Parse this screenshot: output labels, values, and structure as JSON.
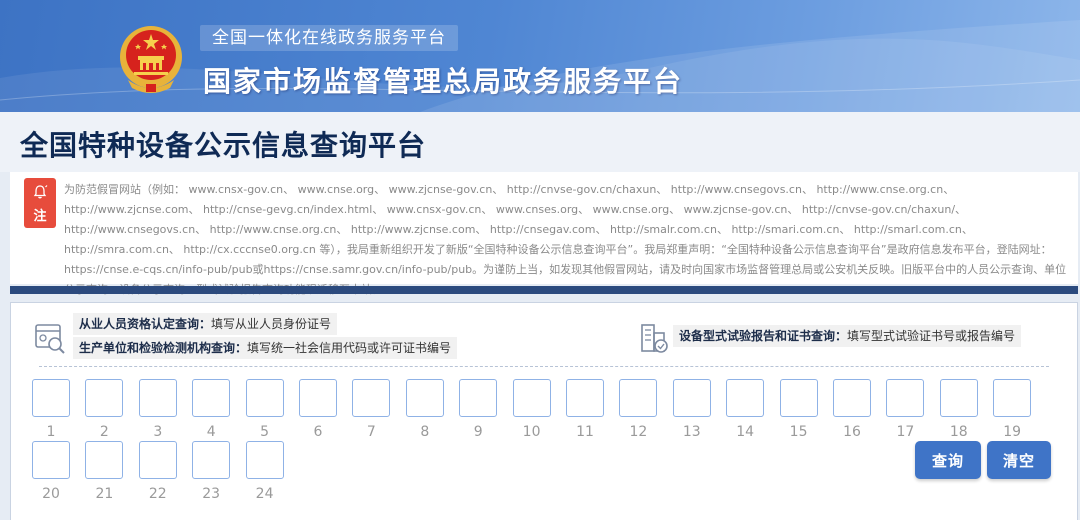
{
  "header": {
    "platform_subtitle": "全国一体化在线政务服务平台",
    "platform_title": "国家市场监督管理总局政务服务平台"
  },
  "page": {
    "title": "全国特种设备公示信息查询平台"
  },
  "notice": {
    "badge_label": "注",
    "text": "为防范假冒网站（例如： www.cnsx-gov.cn、 www.cnse.org、 www.zjcnse-gov.cn、 http://cnvse-gov.cn/chaxun、 http://www.cnsegovs.cn、 http://www.cnse.org.cn、 http://www.zjcnse.com、 http://cnse-gevg.cn/index.html、 www.cnsx-gov.cn、 www.cnses.org、 www.cnse.org、 www.zjcnse-gov.cn、 http://cnvse-gov.cn/chaxun/、 http://www.cnsegovs.cn、 http://www.cnse.org.cn、 http://www.zjcnse.com、 http://cnsegav.com、 http://smalr.com.cn、 http://smari.com.cn、 http://smarl.com.cn、 http://smra.com.cn、 http://cx.cccnse0.org.cn 等），我局重新组织开发了新版“全国特种设备公示信息查询平台”。我局郑重声明：“全国特种设备公示信息查询平台”是政府信息发布平台，登陆网址： https://cnse.e-cqs.cn/info-pub/pub或https://cnse.samr.gov.cn/info-pub/pub。为谨防上当，如发现其他假冒网站，请及时向国家市场监督管理总局或公安机关反映。旧版平台中的人员公示查询、单位公示查询、设备公示查询、型式试验报告查询功能现迁移至本站。"
  },
  "query": {
    "hints": [
      {
        "label": "从业人员资格认定查询：",
        "text": "填写从业人员身份证号"
      },
      {
        "label": "生产单位和检验检测机构查询：",
        "text": "填写统一社会信用代码或许可证书编号"
      },
      {
        "label": "设备型式试验报告和证书查询：",
        "text": "填写型式试验证书号或报告编号"
      }
    ],
    "cells": [
      "1",
      "2",
      "3",
      "4",
      "5",
      "6",
      "7",
      "8",
      "9",
      "10",
      "11",
      "12",
      "13",
      "14",
      "15",
      "16",
      "17",
      "18",
      "19",
      "20",
      "21",
      "22",
      "23",
      "24"
    ],
    "search_label": "查询",
    "clear_label": "清空"
  },
  "colors": {
    "banner": "#4f86d3",
    "title": "#0f2a55",
    "notice_badge": "#e74c3c",
    "divider": "#2b4a7e",
    "button": "#3f74c7",
    "cell_border": "#8fb2e6"
  },
  "icons": {
    "emblem": "national-emblem-icon",
    "notice": "bell-icon",
    "person_query": "id-card-search-icon",
    "equipment_query": "building-icon"
  }
}
